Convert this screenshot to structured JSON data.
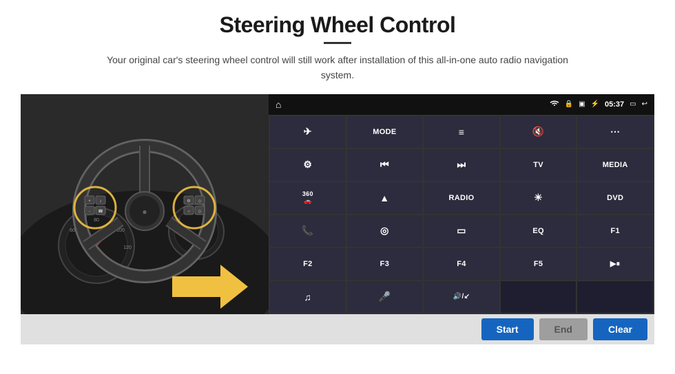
{
  "page": {
    "title": "Steering Wheel Control",
    "subtitle": "Your original car's steering wheel control will still work after installation of this all-in-one auto radio navigation system."
  },
  "status_bar": {
    "time": "05:37",
    "icons": [
      "wifi",
      "lock",
      "sim",
      "bluetooth",
      "cast",
      "back"
    ]
  },
  "buttons": [
    {
      "id": "b0",
      "label": "⌂",
      "type": "icon"
    },
    {
      "id": "b1",
      "label": "✈",
      "type": "icon"
    },
    {
      "id": "b2",
      "label": "MODE",
      "type": "text"
    },
    {
      "id": "b3",
      "label": "≡",
      "type": "icon"
    },
    {
      "id": "b4",
      "label": "🔇",
      "type": "icon"
    },
    {
      "id": "b5",
      "label": "⋯",
      "type": "icon"
    },
    {
      "id": "b6",
      "label": "⚙",
      "type": "icon"
    },
    {
      "id": "b7",
      "label": "⏮",
      "type": "icon"
    },
    {
      "id": "b8",
      "label": "⏭",
      "type": "icon"
    },
    {
      "id": "b9",
      "label": "TV",
      "type": "text"
    },
    {
      "id": "b10",
      "label": "MEDIA",
      "type": "text"
    },
    {
      "id": "b11",
      "label": "360",
      "type": "text-sm"
    },
    {
      "id": "b12",
      "label": "▲",
      "type": "icon"
    },
    {
      "id": "b13",
      "label": "RADIO",
      "type": "text"
    },
    {
      "id": "b14",
      "label": "☀",
      "type": "icon"
    },
    {
      "id": "b15",
      "label": "DVD",
      "type": "text"
    },
    {
      "id": "b16",
      "label": "📞",
      "type": "icon"
    },
    {
      "id": "b17",
      "label": "◎",
      "type": "icon"
    },
    {
      "id": "b18",
      "label": "▭",
      "type": "icon"
    },
    {
      "id": "b19",
      "label": "EQ",
      "type": "text"
    },
    {
      "id": "b20",
      "label": "F1",
      "type": "text"
    },
    {
      "id": "b21",
      "label": "F2",
      "type": "text"
    },
    {
      "id": "b22",
      "label": "F3",
      "type": "text"
    },
    {
      "id": "b23",
      "label": "F4",
      "type": "text"
    },
    {
      "id": "b24",
      "label": "F5",
      "type": "text"
    },
    {
      "id": "b25",
      "label": "▶⏸",
      "type": "text"
    },
    {
      "id": "b26",
      "label": "♫",
      "type": "icon"
    },
    {
      "id": "b27",
      "label": "🎤",
      "type": "icon"
    },
    {
      "id": "b28",
      "label": "🔊/↙",
      "type": "icon"
    },
    {
      "id": "b29",
      "label": "",
      "type": "empty"
    }
  ],
  "bottom_bar": {
    "start_label": "Start",
    "end_label": "End",
    "clear_label": "Clear"
  }
}
